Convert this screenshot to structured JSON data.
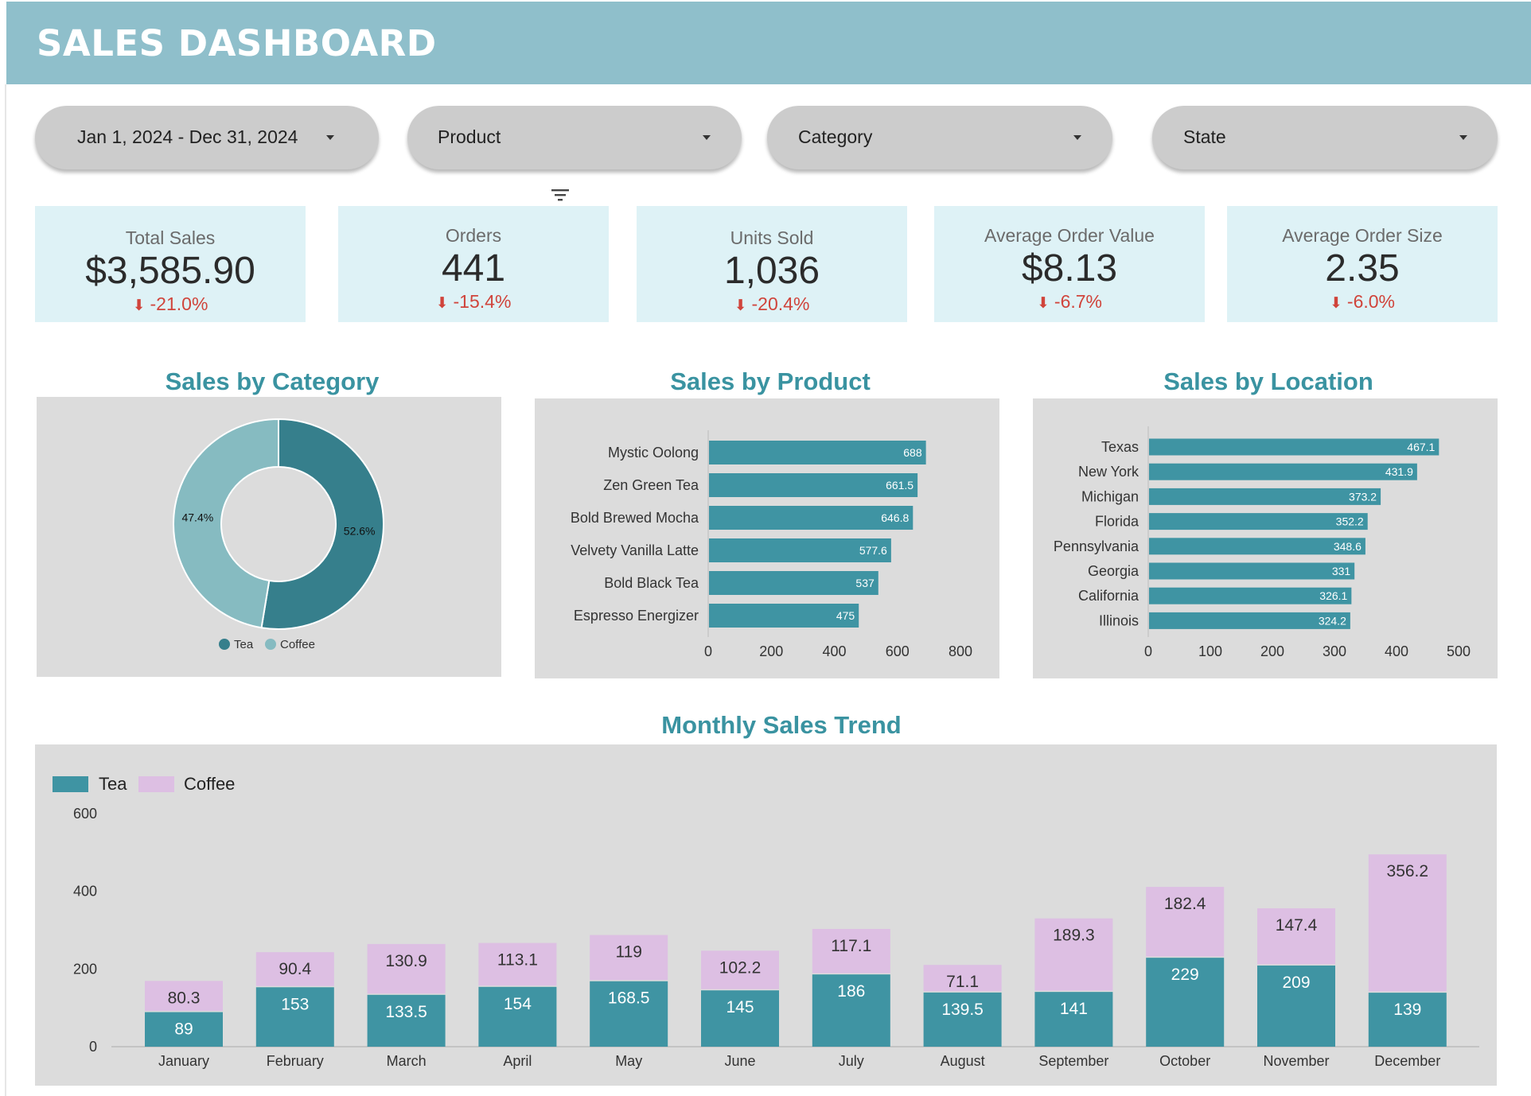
{
  "header": {
    "title": "SALES DASHBOARD"
  },
  "filters": {
    "date_range": "Jan 1, 2024 - Dec 31, 2024",
    "product": "Product",
    "category": "Category",
    "state": "State"
  },
  "icons": {
    "filter": "filter-icon",
    "dropdown": "chevron-down-icon",
    "trend": "arrow-down-icon"
  },
  "colors": {
    "header": "#8fbfcb",
    "kpi_bg": "#def2f6",
    "teal": "#3f94a3",
    "coffee": "#ddbfe3",
    "negative": "#d0443b",
    "section_title": "#3a93a1"
  },
  "kpis": [
    {
      "label": "Total Sales",
      "value": "$3,585.90",
      "delta": "-21.0%"
    },
    {
      "label": "Orders",
      "value": "441",
      "delta": "-15.4%"
    },
    {
      "label": "Units Sold",
      "value": "1,036",
      "delta": "-20.4%"
    },
    {
      "label": "Average Order Value",
      "value": "$8.13",
      "delta": "-6.7%"
    },
    {
      "label": "Average Order Size",
      "value": "2.35",
      "delta": "-6.0%"
    }
  ],
  "chart_data": [
    {
      "type": "pie",
      "title": "Sales by Category",
      "donut": true,
      "categories": [
        "Tea",
        "Coffee"
      ],
      "values": [
        52.6,
        47.4
      ],
      "labels": [
        "52.6%",
        "47.4%"
      ],
      "colors": [
        "#367f8c",
        "#86bbc1"
      ],
      "legend": "bottom"
    },
    {
      "type": "bar",
      "orientation": "horizontal",
      "title": "Sales by Product",
      "categories": [
        "Mystic Oolong",
        "Zen Green Tea",
        "Bold Brewed Mocha",
        "Velvety Vanilla Latte",
        "Bold Black Tea",
        "Espresso Energizer"
      ],
      "values": [
        688,
        661.5,
        646.8,
        577.6,
        537,
        475
      ],
      "xlim": [
        0,
        800
      ],
      "xticks": [
        0,
        200,
        400,
        600,
        800
      ],
      "color": "#3f94a3"
    },
    {
      "type": "bar",
      "orientation": "horizontal",
      "title": "Sales by Location",
      "categories": [
        "Texas",
        "New York",
        "Michigan",
        "Florida",
        "Pennsylvania",
        "Georgia",
        "California",
        "Illinois"
      ],
      "values": [
        467.1,
        431.9,
        373.2,
        352.2,
        348.6,
        331,
        326.1,
        324.2
      ],
      "xlim": [
        0,
        500
      ],
      "xticks": [
        0,
        100,
        200,
        300,
        400,
        500
      ],
      "color": "#3f94a3"
    },
    {
      "type": "bar",
      "stacked": true,
      "title": "Monthly Sales Trend",
      "categories": [
        "January",
        "February",
        "March",
        "April",
        "May",
        "June",
        "July",
        "August",
        "September",
        "October",
        "November",
        "December"
      ],
      "series": [
        {
          "name": "Tea",
          "values": [
            89,
            153,
            133.5,
            154,
            168.5,
            145,
            186,
            139.5,
            141,
            229,
            209,
            139
          ],
          "color": "#3f94a3"
        },
        {
          "name": "Coffee",
          "values": [
            80.3,
            90.4,
            130.9,
            113.1,
            119,
            102.2,
            117.1,
            71.1,
            189.3,
            182.4,
            147.4,
            356.2
          ],
          "color": "#ddbfe3"
        }
      ],
      "ylim": [
        0,
        600
      ],
      "yticks": [
        0,
        200,
        400,
        600
      ],
      "legend": "top-left"
    }
  ]
}
